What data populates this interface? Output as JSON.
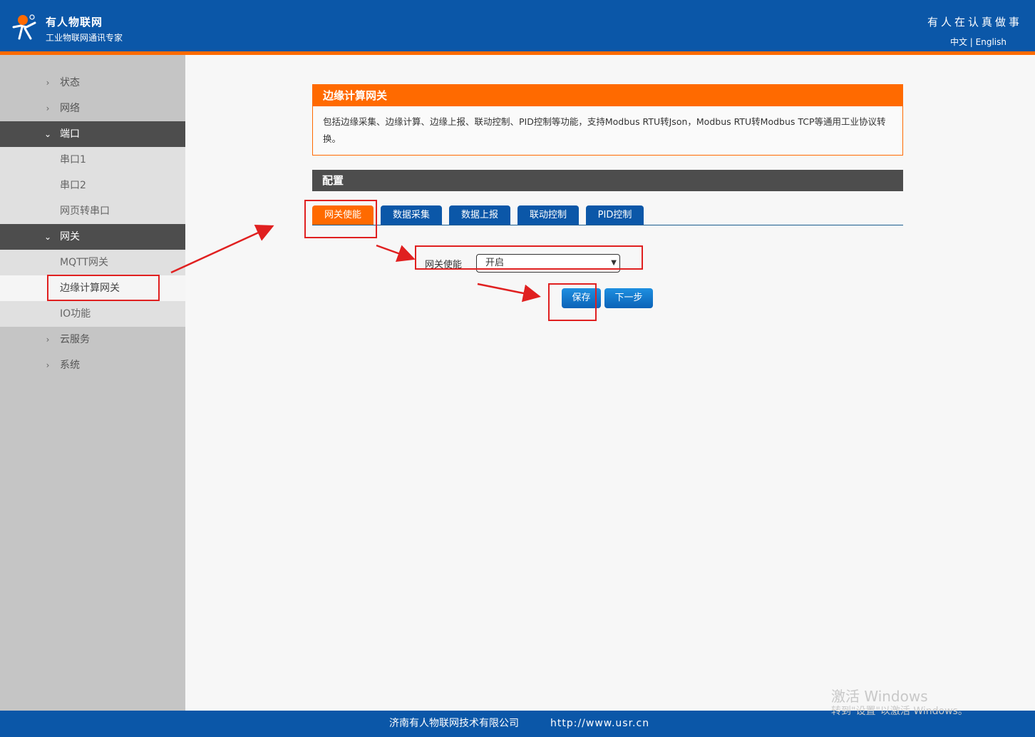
{
  "header": {
    "brand_name": "有人物联网",
    "brand_sub": "工业物联网通讯专家",
    "slogan": "有人在认真做事",
    "lang_zh": "中文",
    "lang_sep": "|",
    "lang_en": "English",
    "logo_icon": "usr-person-logo-icon"
  },
  "sidebar": {
    "items": [
      {
        "label": "状态",
        "icon": "chevron-right-icon"
      },
      {
        "label": "网络",
        "icon": "chevron-right-icon"
      },
      {
        "label": "端口",
        "icon": "chevron-down-icon"
      },
      {
        "label": "串口1"
      },
      {
        "label": "串口2"
      },
      {
        "label": "网页转串口"
      },
      {
        "label": "网关",
        "icon": "chevron-down-icon"
      },
      {
        "label": "MQTT网关"
      },
      {
        "label": "边缘计算网关"
      },
      {
        "label": "IO功能"
      },
      {
        "label": "云服务",
        "icon": "chevron-right-icon"
      },
      {
        "label": "系统",
        "icon": "chevron-right-icon"
      }
    ]
  },
  "intro": {
    "title": "边缘计算网关",
    "description": "包括边缘采集、边缘计算、边缘上报、联动控制、PID控制等功能，支持Modbus RTU转Json，Modbus RTU转Modbus TCP等通用工业协议转换。"
  },
  "config": {
    "title": "配置",
    "tabs": [
      {
        "label": "网关使能"
      },
      {
        "label": "数据采集"
      },
      {
        "label": "数据上报"
      },
      {
        "label": "联动控制"
      },
      {
        "label": "PID控制"
      }
    ],
    "enable_label": "网关使能",
    "enable_value": "开启",
    "save_label": "保存",
    "next_label": "下一步"
  },
  "footer": {
    "company": "济南有人物联网技术有限公司",
    "url": "http://www.usr.cn"
  },
  "watermark": {
    "line1": "激活 Windows",
    "line2": "转到\"设置\"以激活 Windows。"
  },
  "colors": {
    "brand_blue": "#0b57a8",
    "accent_orange": "#ff6a00",
    "annotation_red": "#e02020"
  }
}
